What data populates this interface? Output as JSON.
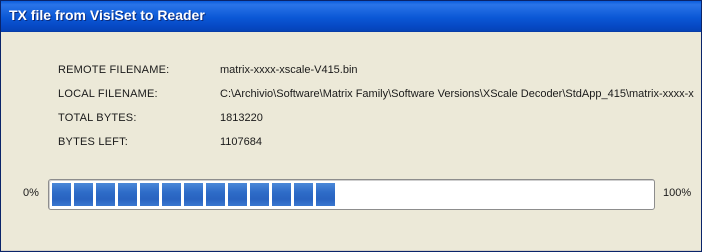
{
  "window": {
    "title": "TX file from VisiSet to Reader"
  },
  "info": [
    {
      "label": "REMOTE FILENAME:",
      "value": "matrix-xxxx-xscale-V415.bin"
    },
    {
      "label": "LOCAL FILENAME:",
      "value": "C:\\Archivio\\Software\\Matrix Family\\Software Versions\\XScale Decoder\\StdApp_415\\matrix-xxxx-x"
    },
    {
      "label": "TOTAL BYTES:",
      "value": "1813220"
    },
    {
      "label": "BYTES LEFT:",
      "value": "1107684"
    }
  ],
  "progress": {
    "min_label": "0%",
    "max_label": "100%",
    "fraction": 0.39,
    "segment_count": 13,
    "color": "#2e6cc8"
  }
}
